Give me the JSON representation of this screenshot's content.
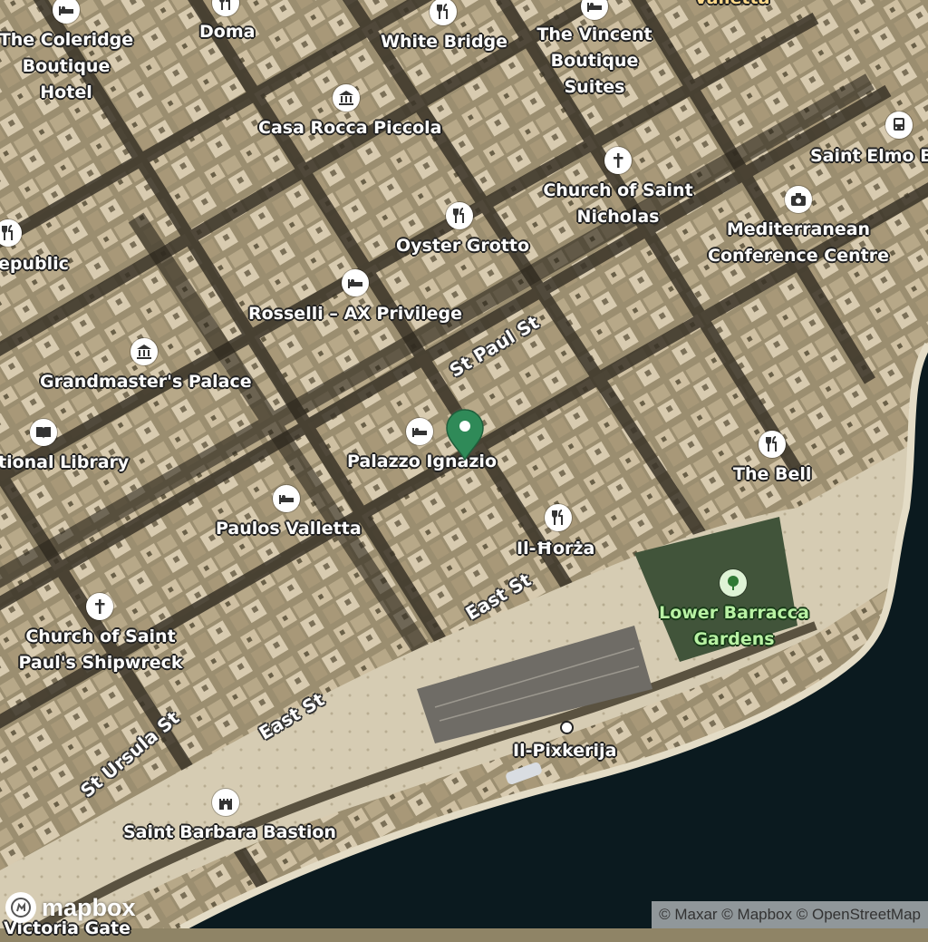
{
  "map": {
    "colors": {
      "land": "#8f8466",
      "roof": "#c7b89a",
      "street": "#3a3428",
      "sea": "#0b1a1f",
      "quay": "#d8cfb8",
      "garden": "#41543a",
      "pin": "#2f8a58"
    },
    "pois": [
      {
        "id": "coleridge",
        "label": "The Coleridge\nBoutique Hotel",
        "icon": "hotel-icon"
      },
      {
        "id": "doma",
        "label": "Doma",
        "icon": "restaurant-icon"
      },
      {
        "id": "white-bridge",
        "label": "White Bridge",
        "icon": "restaurant-icon"
      },
      {
        "id": "vincent",
        "label": "The Vincent\nBoutique Suites",
        "icon": "hotel-icon"
      },
      {
        "id": "valletta-top",
        "label": "Valletta",
        "icon": ""
      },
      {
        "id": "casa-rocca",
        "label": "Casa Rocca Piccola",
        "icon": "museum-icon"
      },
      {
        "id": "saint-elmo",
        "label": "Saint Elmo B",
        "icon": "bus-icon"
      },
      {
        "id": "st-nicholas",
        "label": "Church of Saint\nNicholas",
        "icon": "church-icon"
      },
      {
        "id": "oyster-grotto",
        "label": "Oyster Grotto",
        "icon": "restaurant-icon"
      },
      {
        "id": "mcc",
        "label": "Mediterranean\nConference Centre",
        "icon": "camera-icon"
      },
      {
        "id": "republic",
        "label": "epublic",
        "icon": "restaurant-icon"
      },
      {
        "id": "rosselli",
        "label": "Rosselli – AX Privilege",
        "icon": "hotel-icon"
      },
      {
        "id": "grandmaster",
        "label": "Grandmaster's Palace",
        "icon": "museum-icon"
      },
      {
        "id": "library",
        "label": "tional Library",
        "icon": "library-icon"
      },
      {
        "id": "palazzo",
        "label": "Palazzo Ignazio",
        "icon": "hotel-icon"
      },
      {
        "id": "the-bell",
        "label": "The Bell",
        "icon": "restaurant-icon"
      },
      {
        "id": "paulos",
        "label": "Paulos Valletta",
        "icon": "hotel-icon"
      },
      {
        "id": "il-horza",
        "label": "Il-Ħorża",
        "icon": "restaurant-icon"
      },
      {
        "id": "st-paul-shipwreck",
        "label": "Church of Saint\nPaul's Shipwreck",
        "icon": "church-icon"
      },
      {
        "id": "lower-barracca",
        "label": "Lower Barracca\nGardens",
        "icon": "park-icon"
      },
      {
        "id": "il-pixkerija",
        "label": "Il-Pixkerija",
        "icon": "dot-icon"
      },
      {
        "id": "saint-barbara",
        "label": "Saint Barbara Bastion",
        "icon": "castle-icon"
      },
      {
        "id": "victoria-gate",
        "label": "Victoria Gate",
        "icon": ""
      }
    ],
    "streets": [
      {
        "id": "st-paul-st",
        "label": "St Paul St"
      },
      {
        "id": "east-st-1",
        "label": "East St"
      },
      {
        "id": "east-st-2",
        "label": "East St"
      },
      {
        "id": "st-ursula-st",
        "label": "St Ursula St"
      }
    ],
    "selected_pin": {
      "label": "Palazzo Ignazio"
    }
  },
  "branding": {
    "logo": "mapbox"
  },
  "attribution": "© Maxar © Mapbox © OpenStreetMap"
}
